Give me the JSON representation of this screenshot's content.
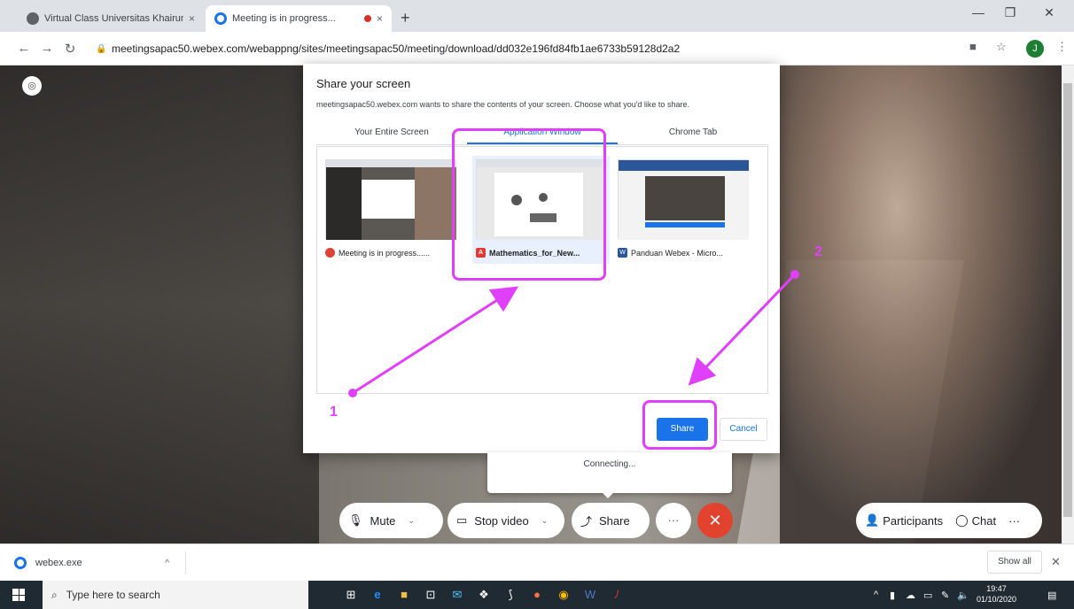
{
  "browser": {
    "tabs": [
      {
        "title": "Virtual Class Universitas Khairun",
        "close": "×"
      },
      {
        "title": "Meeting is in progress...",
        "close": "×"
      }
    ],
    "new_tab": "+",
    "url": "meetingsapac50.webex.com/webappng/sites/meetingsapac50/meeting/download/dd032e196fd84fb1ae6733b59128d2a2",
    "profile_initial": "J"
  },
  "dialog": {
    "title": "Share your screen",
    "description": "meetingsapac50.webex.com wants to share the contents of your screen. Choose what you'd like to share.",
    "tabs": [
      "Your Entire Screen",
      "Application Window",
      "Chrome Tab"
    ],
    "windows": [
      {
        "caption": "Meeting is in progress......"
      },
      {
        "caption": "Mathematics_for_New..."
      },
      {
        "caption": "Panduan Webex - Micro..."
      }
    ],
    "share_label": "Share",
    "cancel_label": "Cancel"
  },
  "connecting_text": "Connecting...",
  "controls": {
    "mute": "Mute",
    "stop_video": "Stop video",
    "share": "Share",
    "more": "···",
    "participants": "Participants",
    "chat": "Chat",
    "right_more": "···"
  },
  "annotations": {
    "step1": "1",
    "step2": "2"
  },
  "downloads": {
    "file": "webex.exe",
    "show_all": "Show all"
  },
  "taskbar": {
    "search_placeholder": "Type here to search",
    "time": "19:47",
    "date": "01/10/2020"
  },
  "colors": {
    "accent": "#1a73e8",
    "highlight": "#e040fb",
    "leave": "#e2432f"
  }
}
